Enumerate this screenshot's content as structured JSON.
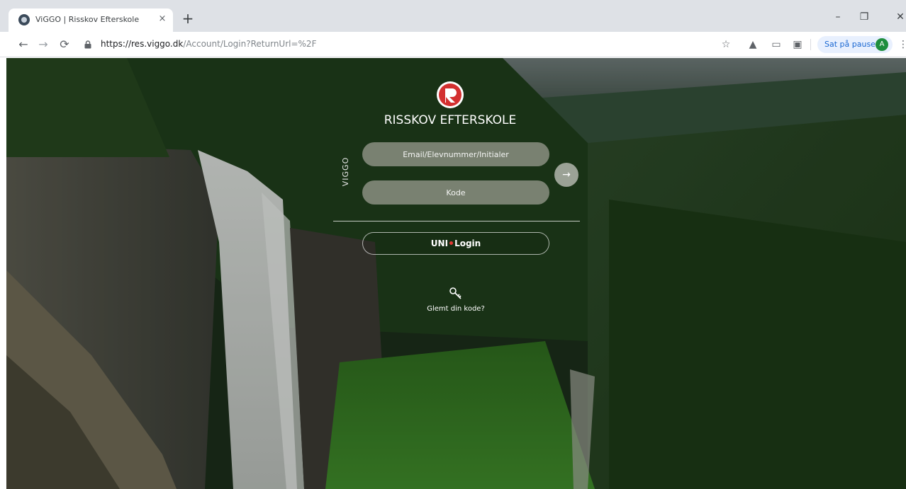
{
  "browser": {
    "tab_title": "ViGGO | Risskov Efterskole",
    "tab_close": "×",
    "new_tab": "+",
    "url_host": "https://res.viggo.dk",
    "url_path": "/Account/Login?ReturnUrl=%2F",
    "profile_label": "Sat på pause",
    "profile_initial": "A",
    "window_min": "–",
    "window_max": "❐",
    "window_close": "✕",
    "icons": [
      "back-icon",
      "forward-icon",
      "reload-icon",
      "lock-icon",
      "star-icon",
      "extension-icon",
      "menu-icon"
    ]
  },
  "login": {
    "school_name": "RISSKOV EFTERSKOLE",
    "vertical_label": "VIGGO",
    "email_placeholder": "Email/Elevnummer/Initialer",
    "code_placeholder": "Kode",
    "submit_arrow": "→",
    "uni_prefix": "UNI",
    "uni_suffix": "Login",
    "forgot_label": "Glemt din kode?",
    "logo_color": "#d32f2f",
    "uni_dot_color": "#e53935"
  }
}
